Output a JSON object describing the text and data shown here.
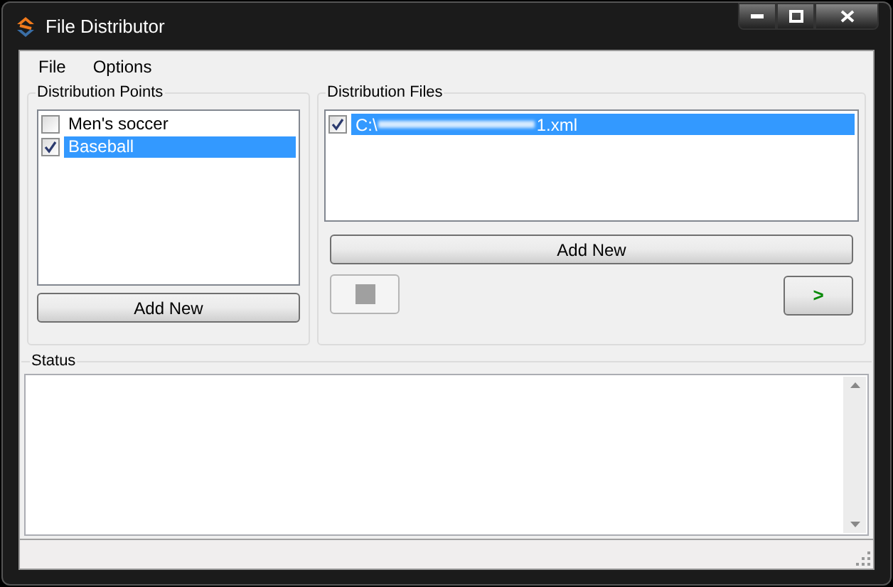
{
  "window": {
    "title": "File Distributor"
  },
  "menu": [
    "File",
    "Options"
  ],
  "distribution_points": {
    "title": "Distribution Points",
    "items": [
      {
        "label": "Men's soccer",
        "checked": false,
        "selected": false
      },
      {
        "label": "Baseball",
        "checked": true,
        "selected": true
      }
    ],
    "button": "Add New"
  },
  "distribution_files": {
    "title": "Distribution Files",
    "items": [
      {
        "path_start": "C:\\",
        "path_end": "1.xml",
        "checked": true,
        "selected": true
      }
    ],
    "button": "Add New",
    "stop_button": {
      "disabled": true
    },
    "go_button": {
      "label": ">"
    }
  },
  "status": {
    "title": "Status"
  }
}
